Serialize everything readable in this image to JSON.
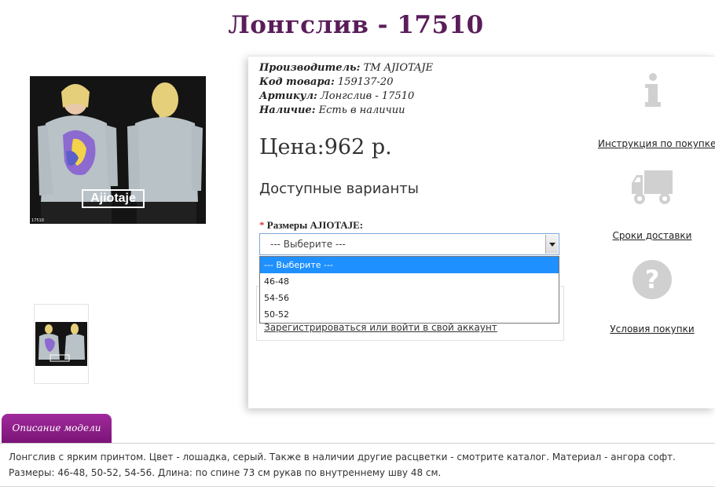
{
  "product": {
    "title": "Лонгслив - 17510",
    "image_alt": "Лонгслив - 17510"
  },
  "info": {
    "manufacturer_label": "Производитель:",
    "manufacturer_value": "ТМ AJIOTAJE",
    "code_label": "Код товара:",
    "code_value": "159137-20",
    "article_label": "Артикул:",
    "article_value": "Лонгслив - 17510",
    "availability_label": "Наличие:",
    "availability_value": "Есть в наличии",
    "price": "Цена:962 р."
  },
  "options": {
    "heading": "Доступные варианты",
    "required_mark": "*",
    "size_label": "Размеры AJIOTAJE:",
    "selected": "--- Выберите ---",
    "list": [
      "--- Выберите ---",
      "46-48",
      "54-56",
      "50-52"
    ]
  },
  "login": {
    "link": "Зарегистрироваться или войти в свой аккаунт"
  },
  "sidebar": {
    "instruction": "Инструкция по покупке",
    "delivery": "Сроки доставки",
    "conditions": "Условия покупки"
  },
  "description": {
    "tab": "Описание модели",
    "text": "Лонгслив с ярким принтом. Цвет - лошадка, серый. Также в наличии другие расцветки - смотрите каталог. Материал - ангора софт. Размеры: 46-48, 50-52, 54-56. Длина: по спине 73 см рукав по внутреннему шву 48 см."
  },
  "colors": {
    "title": "#5a1d5a",
    "tab": "#8b1b86",
    "highlight": "#1e90ff",
    "icon_gray": "#d0d0d0"
  },
  "icons": [
    "info-icon",
    "truck-icon",
    "question-icon",
    "dropdown-arrow-icon"
  ],
  "image_text": {
    "brand": "Ajiotaje",
    "sku_tag": "17510"
  }
}
